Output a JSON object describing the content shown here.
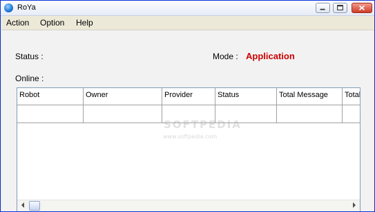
{
  "window": {
    "title": "RoYa"
  },
  "menu": {
    "items": [
      "Action",
      "Option",
      "Help"
    ]
  },
  "status": {
    "label": "Status :",
    "value": ""
  },
  "mode": {
    "label": "Mode :",
    "value": "Application",
    "value_color": "#cc0000"
  },
  "online": {
    "label": "Online :"
  },
  "table": {
    "columns": [
      "Robot",
      "Owner",
      "Provider",
      "Status",
      "Total Message",
      "Total"
    ],
    "rows": []
  },
  "watermark": {
    "text": "SOFTPEDIA",
    "url": "www.softpedia.com"
  },
  "icons": {
    "app": "app-logo-icon",
    "minimize": "minimize-icon",
    "maximize": "maximize-icon",
    "close": "close-icon"
  }
}
